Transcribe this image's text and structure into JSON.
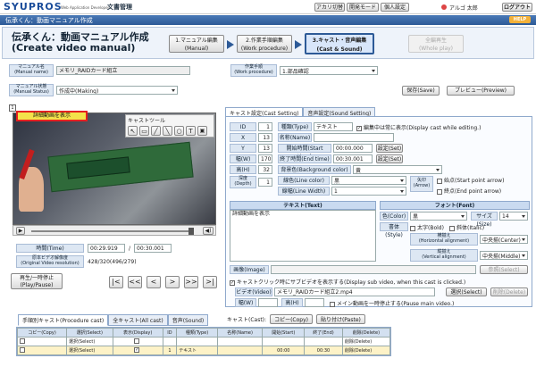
{
  "brand": {
    "name": "SYUPROS",
    "sub": "Web Application Developer",
    "section": "文書管理"
  },
  "topnav": [
    "アカリ切替",
    "開発モード",
    "個人設定"
  ],
  "user": "アルゴ 太郎",
  "logout": "ログアウト",
  "banner": "伝承くん：動画マニュアル作成",
  "help": "HELP",
  "page_title": {
    "jp": "伝承くん：動画マニュアル作成",
    "en": "(Create video manual)"
  },
  "steps": [
    {
      "jp": "1.マニュアル編集",
      "en": "(Manual)"
    },
    {
      "jp": "2.作業手順編集",
      "en": "(Work procedure)"
    },
    {
      "jp": "3.キャスト・音声編集",
      "en": "(Cast & Sound)"
    },
    {
      "jp": "全編再生",
      "en": "(Whole play)"
    }
  ],
  "manual": {
    "name_lbl": "マニュアル名",
    "name_en": "(Manual name)",
    "name": "メモリ_RAIDカード組立",
    "status_lbl": "マニュアル状態",
    "status_en": "(Manual Status)",
    "status": "作成中(Making)"
  },
  "procedure": {
    "lbl": "作業手順",
    "lbl_en": "(Work procedure)",
    "value": "1.部品確認"
  },
  "save": "保存(Save)",
  "preview": "プレビュー(Preview)",
  "video": {
    "cast_label": "詳細動画を表示",
    "toolbox_title": "キャストツール",
    "marker": "1",
    "time_lbl": "時間(Time)",
    "time": "00:29.919",
    "total": "00:30.001",
    "res_lbl": "原本ビデオ解像度",
    "res_en": "(Original Video resolution)",
    "res": "428/320(496/279)",
    "playpause": "再生/一時停止",
    "playpause_en": "(Play/Pause)"
  },
  "ctabs": [
    "キャスト設定(Cast Setting)",
    "音声設定(Sound Setting)"
  ],
  "cast": {
    "id_lbl": "ID",
    "id": "1",
    "type_lbl": "種類(Type)",
    "type": "テキスト",
    "always": "編集中は常に表示(Display cast while editing.)",
    "x_lbl": "X",
    "x": "13",
    "name_lbl": "名称(Name)",
    "name": "",
    "y_lbl": "Y",
    "y": "13",
    "start_lbl": "開始時間(Start time)",
    "start": "00:00.000",
    "set": "設定(Set)",
    "w_lbl": "幅(W)",
    "w": "170",
    "end_lbl": "終了時間(End time)",
    "end": "00:30.001",
    "h_lbl": "高(H)",
    "h": "32",
    "bg_lbl": "背景色(Background color)",
    "bg": "黄",
    "depth_lbl": "深度",
    "depth_en": "(Depth)",
    "depth": "1",
    "lc_lbl": "線色(Line color)",
    "lc": "黒",
    "arrow": "矢印",
    "arrow_en": "(Arrow)",
    "sp": "始点(Start point arrow)",
    "ep": "終点(End point arrow)",
    "lw_lbl": "線幅(Line Width)",
    "lw": "1"
  },
  "text": {
    "lbl": "テキスト(Text)",
    "value": "詳細動画を表示"
  },
  "font": {
    "lbl": "フォント(Font)",
    "color_lbl": "色(Color)",
    "color": "黒",
    "size_lbl": "サイズ(Size)",
    "size": "14",
    "style_lbl": "書体(Style)",
    "bold": "太字(Bold)",
    "italic": "斜体(Italic)",
    "halign_lbl": "横揃え",
    "halign_en": "(Horizontal alignment)",
    "halign": "中央揃(Center)",
    "valign_lbl": "縦揃え",
    "valign_en": "(Vertical alignment)",
    "valign": "中央揃(Middle)"
  },
  "image": {
    "lbl": "画像(Image)",
    "ref": "参照(Select)"
  },
  "subvid": {
    "check": "キャストクリック時にサブビデオを表示する(Display sub video, when this cast is clicked.)",
    "video_lbl": "ビデオ(Video)",
    "video": "メモリ_RAIDカード組立2.mp4",
    "select": "選択(Select)",
    "del": "削除(Delete)",
    "w_lbl": "幅(W)",
    "w": "",
    "h_lbl": "高(H)",
    "h": "",
    "pause": "メイン動画を一時停止する(Pause main video.)"
  },
  "btabs": [
    "手順別キャスト(Procedure cast)",
    "全キャスト(All cast)",
    "音声(Sound)"
  ],
  "cast_actions": {
    "lbl": "キャスト(Cast):",
    "copy": "コピー(Copy)",
    "paste": "貼り付け(Paste)"
  },
  "table": {
    "headers": [
      "コピー(Copy)",
      "選択(Select)",
      "表示(Display)",
      "ID",
      "種類(Type)",
      "名称(Name)",
      "開始(Start)",
      "終了(End)",
      "削除(Delete)"
    ],
    "rows": [
      [
        "",
        "選択(Select)",
        "",
        "",
        "",
        "",
        "",
        "",
        "削除(Delete)"
      ],
      [
        "",
        "選択(Select)",
        "✓",
        "1",
        "テキスト",
        "",
        "00:00",
        "00:30",
        "削除(Delete)"
      ]
    ]
  }
}
